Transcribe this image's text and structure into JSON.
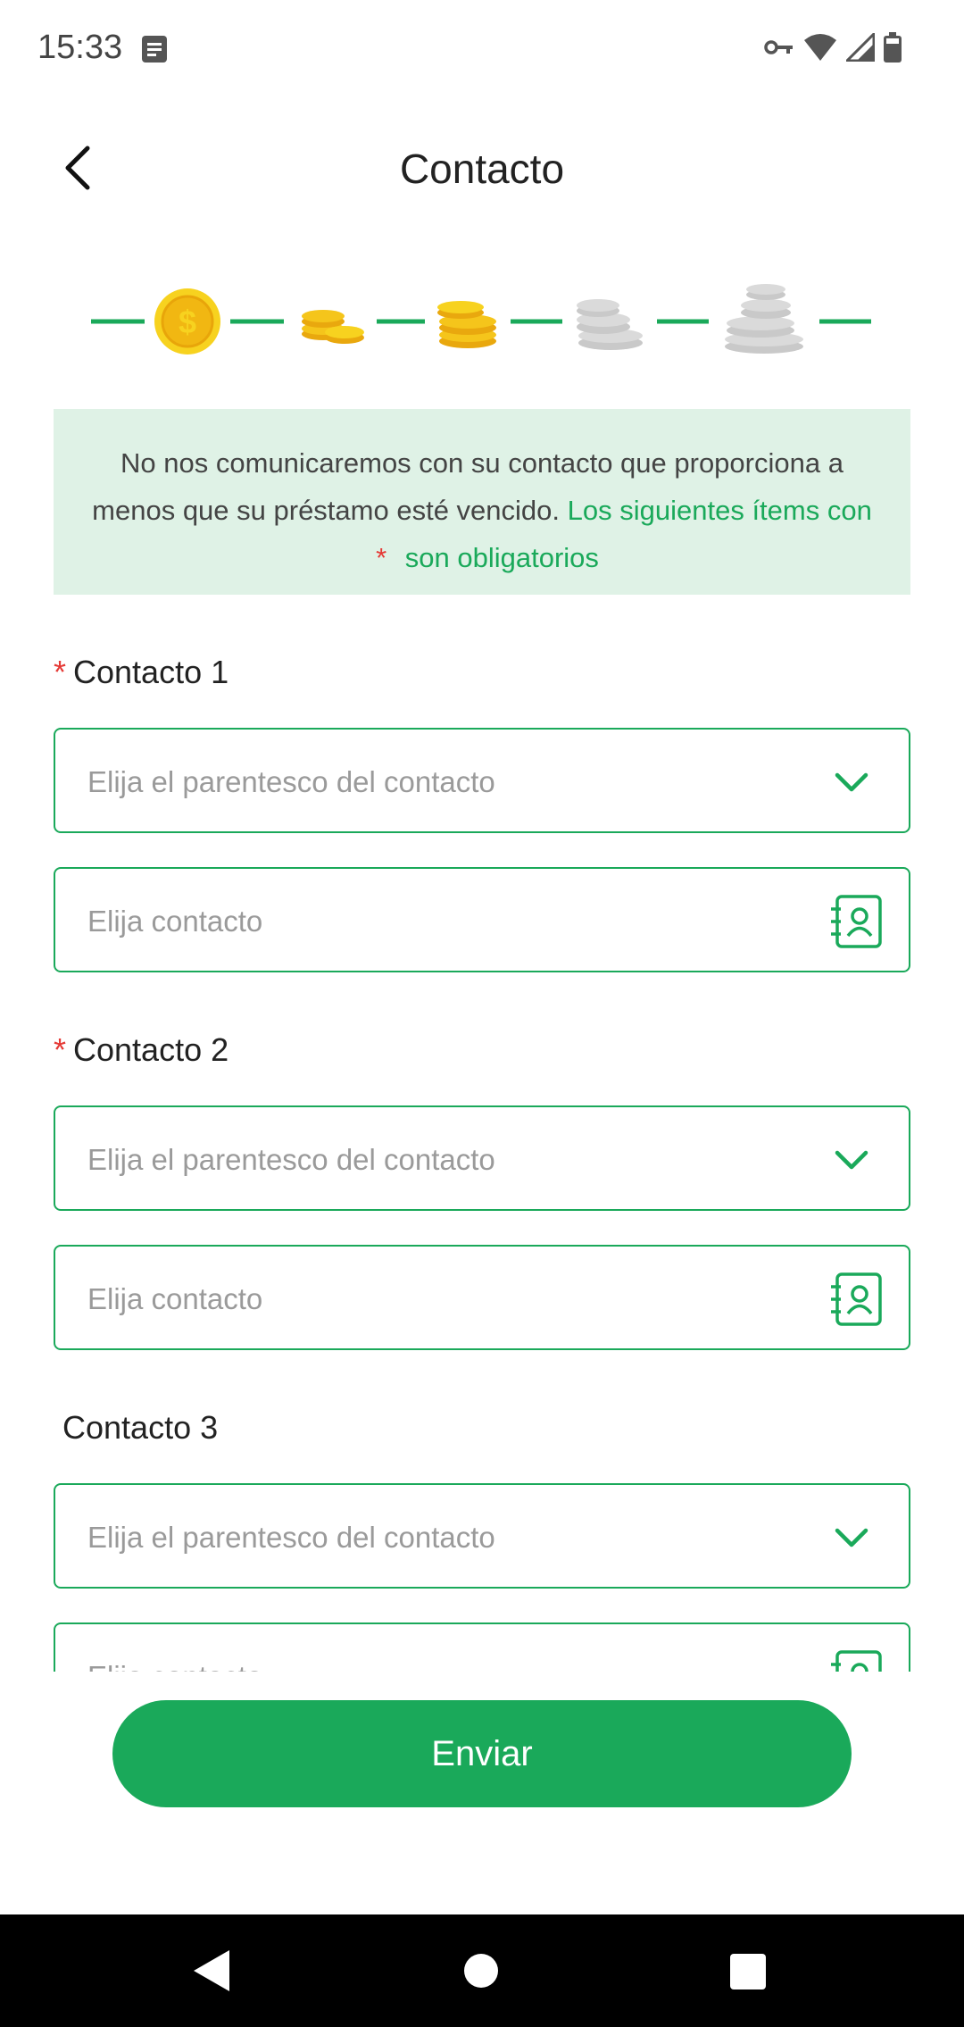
{
  "status": {
    "time": "15:33",
    "icons": [
      "notification-icon",
      "vpn-key-icon",
      "wifi-icon",
      "signal-icon",
      "battery-icon"
    ]
  },
  "header": {
    "title": "Contacto",
    "back_icon": "back-arrow-icon"
  },
  "progress": {
    "steps": [
      "single-coin-icon",
      "coin-stack-small-icon",
      "coin-stack-medium-icon",
      "coin-stack-gray-icon",
      "coin-pile-gray-icon"
    ],
    "active_step": 1
  },
  "notice": {
    "text": "No nos comunicaremos con su contacto que proporciona a menos que su préstamo esté vencido.",
    "required_part1": "Los siguientes ítems con",
    "star": "*",
    "required_part2": "son obligatorios"
  },
  "contacts": [
    {
      "label": "Contacto 1",
      "required": true,
      "relation_placeholder": "Elija el parentesco del contacto",
      "contact_placeholder": "Elija contacto"
    },
    {
      "label": "Contacto 2",
      "required": true,
      "relation_placeholder": "Elija el parentesco del contacto",
      "contact_placeholder": "Elija contacto"
    },
    {
      "label": "Contacto 3",
      "required": false,
      "relation_placeholder": "Elija el parentesco del contacto",
      "contact_placeholder": "Elija contacto"
    }
  ],
  "required_star": "*",
  "submit_label": "Enviar",
  "colors": {
    "accent": "#1aa95a",
    "notice_bg": "#dff2e6",
    "required": "#e53935"
  }
}
